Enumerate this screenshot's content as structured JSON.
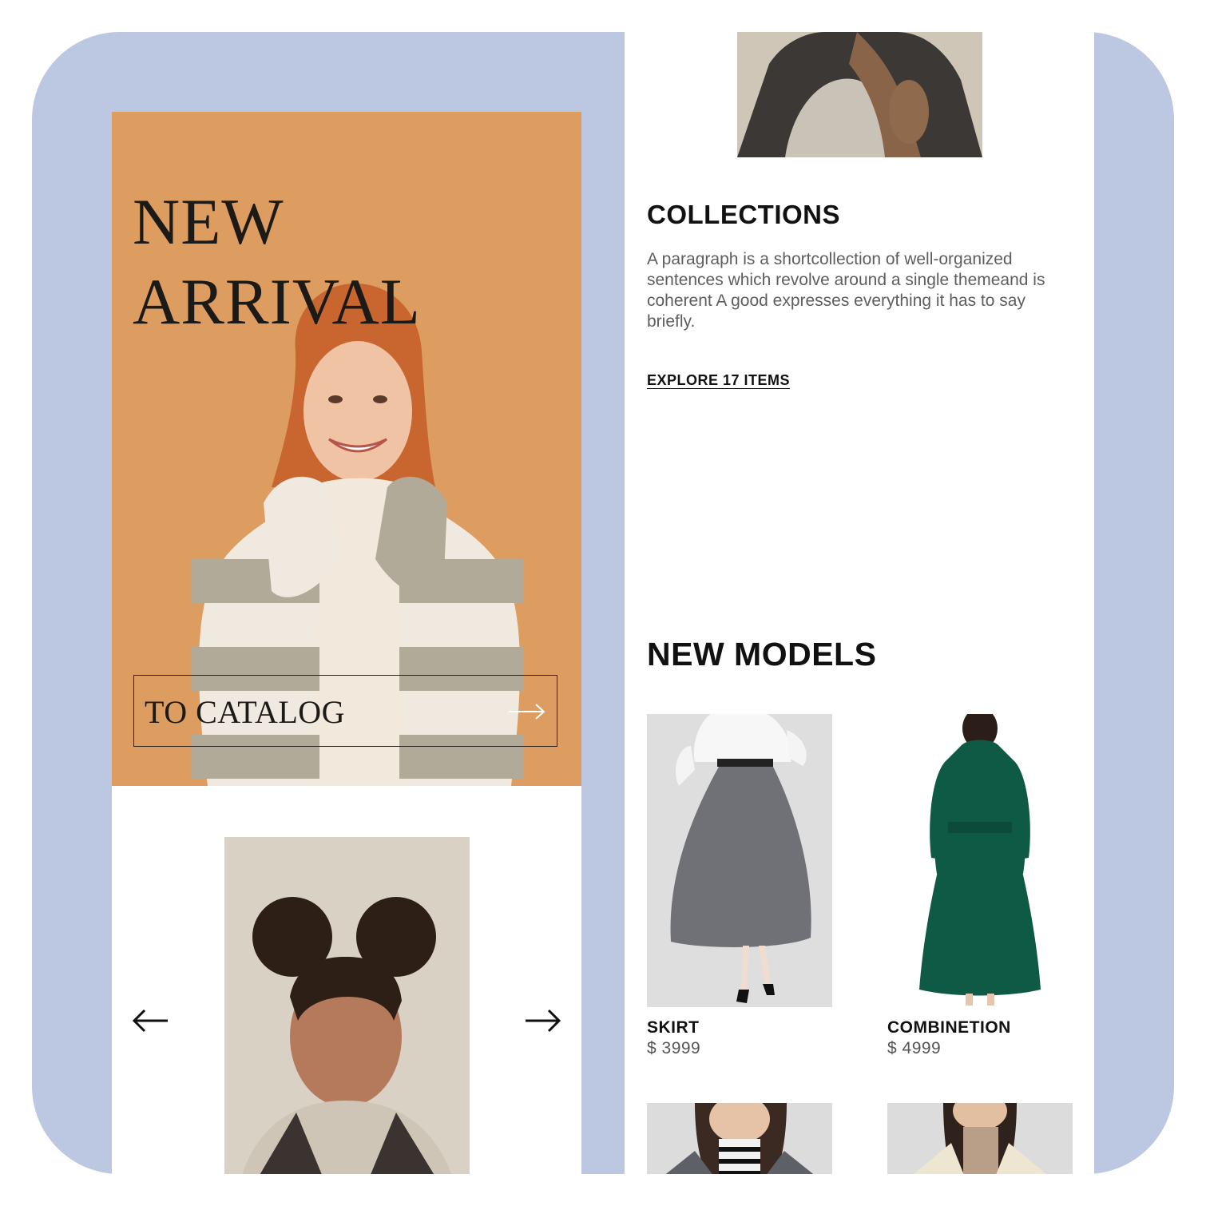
{
  "hero": {
    "title_line1": "NEW",
    "title_line2": "ARRIVAL",
    "catalog_label": "TO CATALOG",
    "background_color": "#dd9c60"
  },
  "slider": {
    "prev_icon": "arrow-left-icon",
    "next_icon": "arrow-right-icon"
  },
  "collections": {
    "title": "COLLECTIONS",
    "text": "A paragraph is a shortcollection of well-organized sentences which revolve around a single themeand is coherent A good expresses everything it has to say briefly.",
    "link": "EXPLORE 17 ITEMS"
  },
  "new_models": {
    "title": "NEW MODELS",
    "products": [
      {
        "name": "SKIRT",
        "price": "$ 3999"
      },
      {
        "name": "COMBINETION",
        "price": "$ 4999"
      }
    ]
  },
  "colors": {
    "frame": "#bcc7e1",
    "text_dark": "#111111",
    "text_muted": "#5e5e5e"
  }
}
